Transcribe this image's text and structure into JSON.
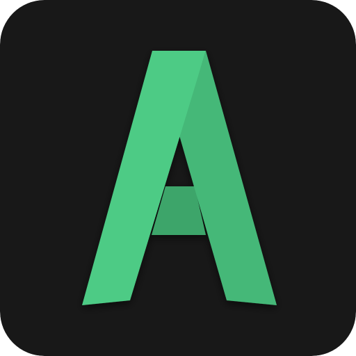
{
  "app_icon": {
    "icon": "letter-a-logo-icon",
    "colors": {
      "background": "#181818",
      "green_light": "#4ECB85",
      "green_mid": "#45B878",
      "green_dark": "#3DA56B"
    }
  }
}
